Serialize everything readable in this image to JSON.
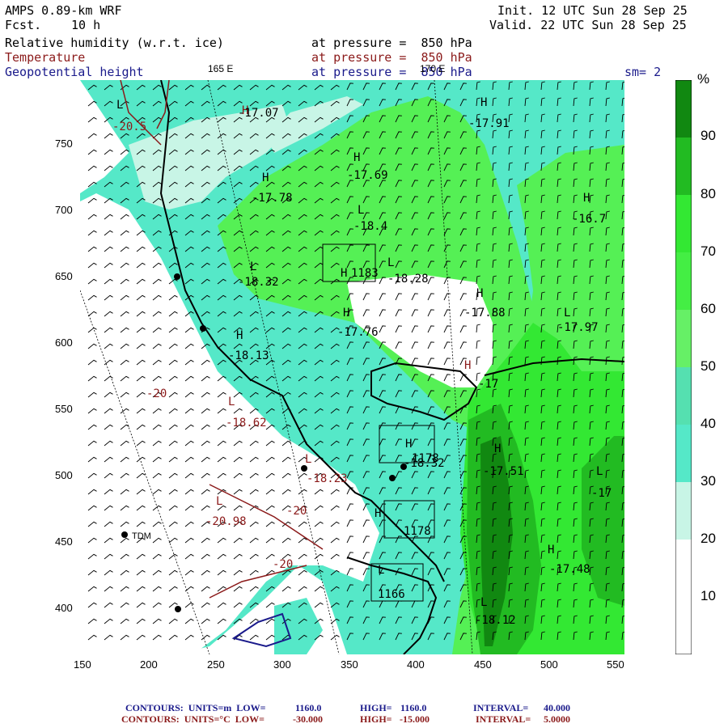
{
  "header": {
    "model": "AMPS 0.89-km WRF",
    "fcst_label": "Fcst.",
    "fcst_value": "10 h",
    "init": "Init. 12 UTC Sun 28 Sep 25",
    "valid": "Valid. 22 UTC Sun 28 Sep 25",
    "field1": "Relative humidity (w.r.t. ice)",
    "field2": "Temperature",
    "field3": "Geopotential height",
    "pressure1": "at pressure =  850 hPa",
    "pressure2": "at pressure =  850 hPa",
    "pressure3": "at pressure =  850 hPa",
    "smoothing": "sm= 2",
    "lon_label_left": "165 E",
    "lon_label_right": "170 E"
  },
  "colors": {
    "rh_0_30": "#ffffff",
    "rh_30_40": "#c8f5e6",
    "rh_40_50": "#55e8c8",
    "rh_50_60": "#55e0b0",
    "rh_60_70": "#55f055",
    "rh_70_80": "#33e833",
    "rh_80_90": "#22bb22",
    "rh_90_100": "#118811",
    "temperature_contour": "#8b1a1a",
    "height_contour": "#1a1a8b",
    "coastline": "#000000"
  },
  "axes": {
    "x_ticks": [
      "150",
      "200",
      "250",
      "300",
      "350",
      "400",
      "450",
      "500",
      "550"
    ],
    "y_ticks": [
      "750",
      "700",
      "650",
      "600",
      "550",
      "500",
      "450",
      "400"
    ]
  },
  "colorbar": {
    "unit": "%",
    "labels": [
      "90",
      "80",
      "70",
      "60",
      "50",
      "40",
      "30",
      "20",
      "10"
    ]
  },
  "map_labels": {
    "highs_lows": [
      {
        "mark": "L",
        "val": "-20.5"
      },
      {
        "mark": "H",
        "val": "-17.07"
      },
      {
        "mark": "H",
        "val": "-17.91"
      },
      {
        "mark": "H",
        "val": "-17.69"
      },
      {
        "mark": "H",
        "val": "-17.78"
      },
      {
        "mark": "L",
        "val": "-18.4"
      },
      {
        "mark": "H",
        "val": "-16.7"
      },
      {
        "mark": "H",
        "val": "1183"
      },
      {
        "mark": "L",
        "val": "-18.28"
      },
      {
        "mark": "L",
        "val": "-18.32"
      },
      {
        "mark": "H",
        "val": "-17.88"
      },
      {
        "mark": "H",
        "val": "-17.76"
      },
      {
        "mark": "L",
        "val": "-17.97"
      },
      {
        "mark": "H",
        "val": "-18.13"
      },
      {
        "mark": "L",
        "val": "-18.62"
      },
      {
        "mark": "H",
        "val": "-17"
      },
      {
        "mark": "H",
        "val": "1178"
      },
      {
        "mark": "",
        "val": "-18.32"
      },
      {
        "mark": "H",
        "val": "-17.51"
      },
      {
        "mark": "L",
        "val": "-18.23"
      },
      {
        "mark": "L",
        "val": "-17"
      },
      {
        "mark": "L",
        "val": "-20.98"
      },
      {
        "mark": "H",
        "val": "1178"
      },
      {
        "mark": "H",
        "val": "-17.48"
      },
      {
        "mark": "L",
        "val": "1166"
      },
      {
        "mark": "L",
        "val": "-18.12"
      }
    ],
    "contour_values": [
      "-20",
      "-20",
      "-20"
    ],
    "station": "TDM"
  },
  "footer": {
    "line1_label": "CONTOURS:  UNITS=m  LOW=",
    "line1_low": "1160.0",
    "line1_high_label": "HIGH=",
    "line1_high": "1160.0",
    "line1_int_label": "INTERVAL=",
    "line1_int": "40.000",
    "line2_label": "CONTOURS:  UNITS=°C  LOW=",
    "line2_low": "-30.000",
    "line2_high_label": "HIGH=",
    "line2_high": "-15.000",
    "line2_int_label": "INTERVAL=",
    "line2_int": "5.0000"
  }
}
